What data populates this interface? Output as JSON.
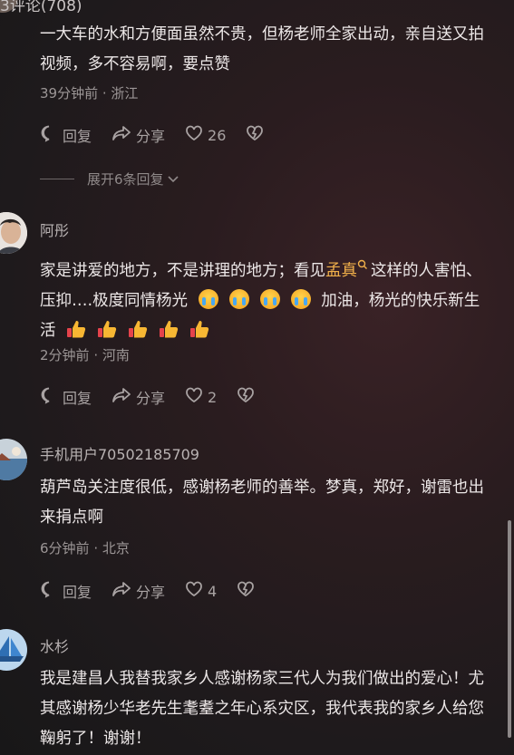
{
  "header": {
    "comment_count_label": "3评论(708)"
  },
  "actions_labels": {
    "reply": "回复",
    "share": "分享"
  },
  "comments": [
    {
      "text": "一大车的水和方便面虽然不贵，但杨老师全家出动，亲自送又拍视频，多不容易啊，要点赞",
      "time": "39分钟前",
      "location": "· 浙江",
      "likes": "26",
      "expand_label": "展开6条回复"
    },
    {
      "name": "阿彤",
      "text_before": "家是讲爱的地方，不是讲理的地方；看见",
      "mention": "孟真",
      "text_middle": "这样的人害怕、压抑….极度同情杨光",
      "text_after": "加油，杨光的快乐新生活",
      "time": "2分钟前",
      "location": "· 河南",
      "likes": "2"
    },
    {
      "name": "手机用户70502185709",
      "text": "葫芦岛关注度很低，感谢杨老师的善举。梦真，郑好，谢雷也出来捐点啊",
      "time": "6分钟前",
      "location": "· 北京",
      "likes": "4"
    },
    {
      "name": "水杉",
      "text": "我是建昌人我替我家乡人感谢杨家三代人为我们做出的爱心！尤其感谢杨少华老先生耄耋之年心系灾区，我代表我的家乡人给您鞠躬了！谢谢！"
    }
  ],
  "icons": [
    "comment-icon",
    "share-icon",
    "heart-icon",
    "broken-heart-icon",
    "search-icon",
    "chevron-down-icon",
    "crying-emoji-icon",
    "thumbs-up-emoji-icon"
  ]
}
